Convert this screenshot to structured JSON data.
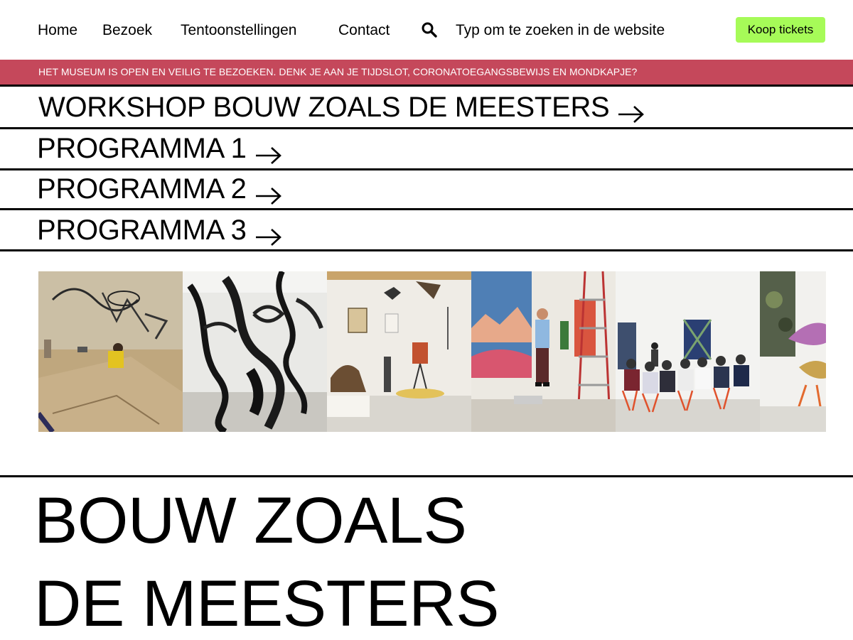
{
  "nav": {
    "items": [
      {
        "label": "Home"
      },
      {
        "label": "Bezoek"
      },
      {
        "label": "Tentoonstellingen"
      },
      {
        "label": "Contact"
      }
    ],
    "search_placeholder": "Typ om te zoeken in de website",
    "search_icon": "search-icon",
    "cta_label": "Koop tickets",
    "cta_color": "#a6fb58"
  },
  "banner": {
    "text": "HET MUSEUM IS OPEN EN VEILIG TE BEZOEKEN. DENK JE AAN JE TIJDSLOT, CORONATOEGANGSBEWIJS EN MONDKAPJE?",
    "color": "#c5485b"
  },
  "links": [
    {
      "label": "WORKSHOP BOUW ZOALS DE MEESTERS"
    },
    {
      "label": "PROGRAMMA 1"
    },
    {
      "label": "PROGRAMMA 2"
    },
    {
      "label": "PROGRAMMA 3"
    }
  ],
  "arrow_icon": "arrow-right-icon",
  "title": {
    "line1": "BOUW ZOALS",
    "line2": "DE MEESTERS"
  }
}
